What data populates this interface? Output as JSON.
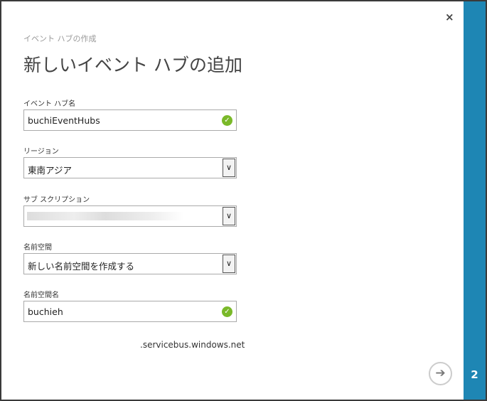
{
  "header": {
    "subtitle": "イベント ハブの作成",
    "title": "新しいイベント ハブの追加",
    "close": "×"
  },
  "fields": {
    "hub_name": {
      "label": "イベント ハブ名",
      "value": "buchiEventHubs"
    },
    "region": {
      "label": "リージョン",
      "value": "東南アジア"
    },
    "subscription": {
      "label": "サブ スクリプション",
      "value": ""
    },
    "namespace": {
      "label": "名前空間",
      "value": "新しい名前空間を作成する"
    },
    "namespace_name": {
      "label": "名前空間名",
      "value": "buchieh",
      "suffix": ".servicebus.windows.net"
    }
  },
  "footer": {
    "next": "➔",
    "step": "2"
  },
  "colors": {
    "accent": "#1e86b4",
    "valid": "#7ab929"
  }
}
